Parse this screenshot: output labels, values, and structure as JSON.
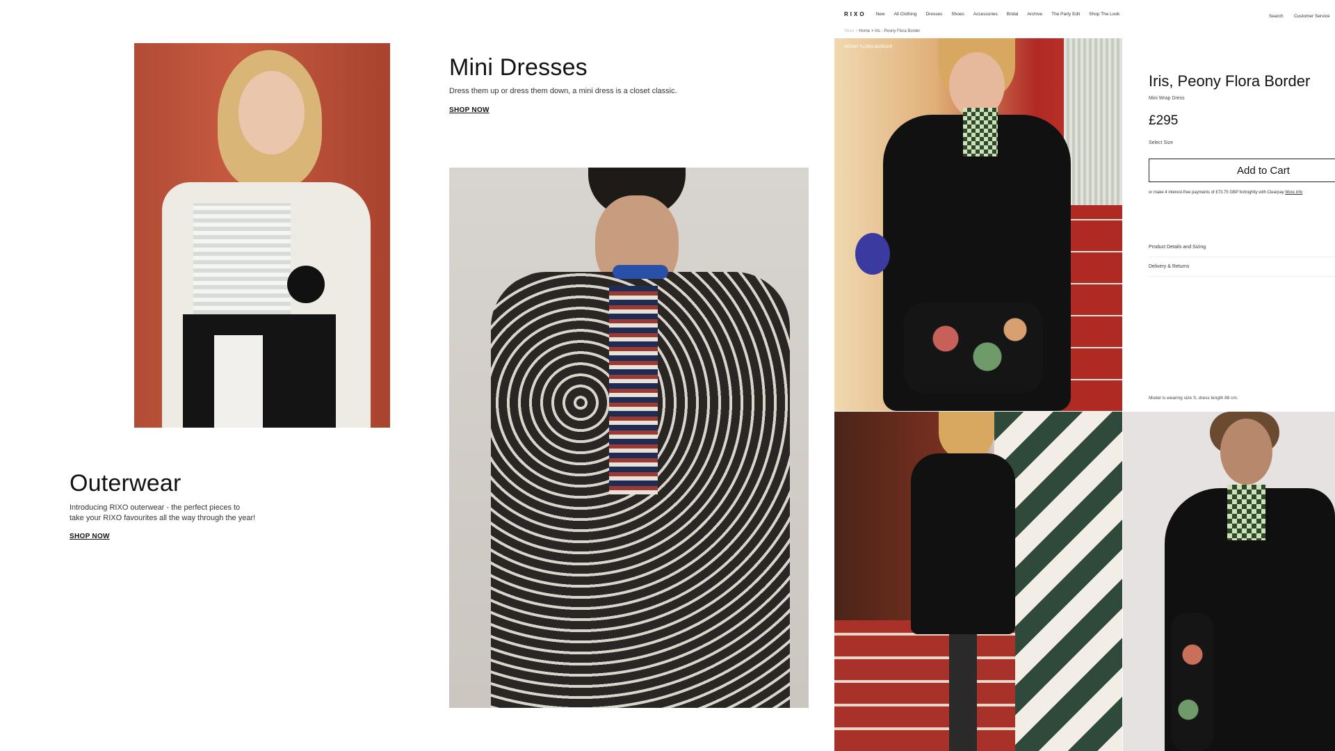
{
  "outerwear": {
    "title": "Outerwear",
    "desc_line1": "Introducing RIXO outerwear - the perfect pieces to",
    "desc_line2": "take your RIXO favourites all the way through the year!",
    "cta": "SHOP NOW"
  },
  "mini_dresses": {
    "title": "Mini Dresses",
    "desc": "Dress them up or dress them down, a mini dress is a closet classic.",
    "cta": "SHOP NOW"
  },
  "pdp": {
    "logo": "RIXO",
    "nav": [
      "New",
      "All Clothing",
      "Dresses",
      "Shoes",
      "Accessories",
      "Bridal",
      "Archive",
      "The Party Edit",
      "Shop The Look"
    ],
    "nav_right": [
      "Search",
      "Customer Service"
    ],
    "breadcrumb_muted": "Store >",
    "breadcrumb": "Home > Iris - Peony Flora Border",
    "image_label": "PEONY FLORA BORDER",
    "title": "Iris, Peony Flora Border",
    "subtitle": "Mini Wrap Dress",
    "price": "£295",
    "select_size": "Select Size",
    "add_to_cart": "Add to Cart",
    "clearpay_text": "or make 4 interest-free payments of £73.75 GBP fortnightly with Clearpay",
    "clearpay_more": "More info",
    "accordion": [
      "Product Details and Sizing",
      "Delivery & Returns"
    ],
    "model_note": "Model is wearing size S, dress length 88 cm."
  },
  "colors": {
    "accent": "#111111",
    "bg": "#ffffff"
  }
}
